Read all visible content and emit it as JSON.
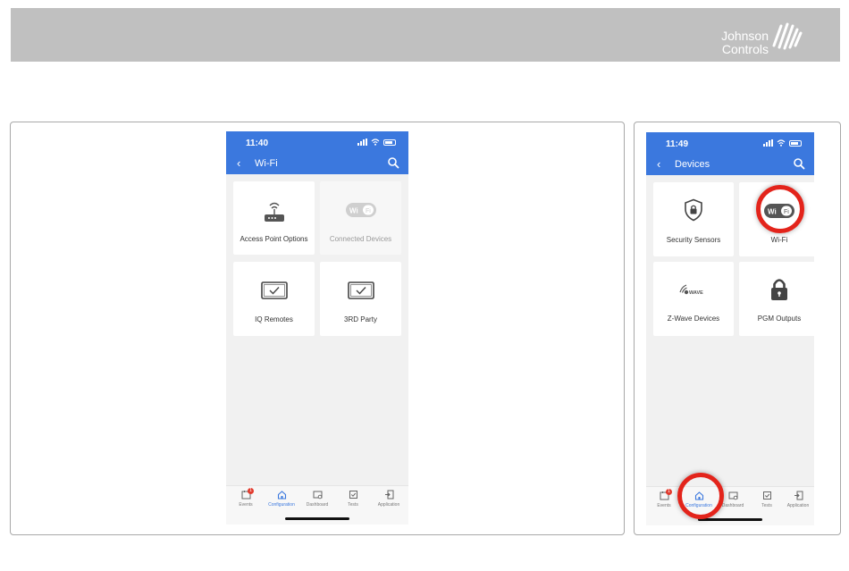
{
  "brand": {
    "line1": "Johnson",
    "line2": "Controls"
  },
  "left_phone": {
    "time": "11:40",
    "title": "Wi-Fi",
    "tiles": [
      {
        "label": "Access Point Options",
        "icon": "router-icon",
        "disabled": false
      },
      {
        "label": "Connected Devices",
        "icon": "wifi-logo-icon",
        "disabled": true
      },
      {
        "label": "IQ Remotes",
        "icon": "tablet-check-icon",
        "disabled": false
      },
      {
        "label": "3RD Party",
        "icon": "tablet-check-icon",
        "disabled": false
      }
    ],
    "tabs": [
      {
        "label": "Events",
        "icon": "events-icon",
        "badge": "1"
      },
      {
        "label": "Configuration",
        "icon": "home-icon",
        "active": true
      },
      {
        "label": "Dashboard",
        "icon": "dashboard-icon"
      },
      {
        "label": "Tests",
        "icon": "tests-icon"
      },
      {
        "label": "Application",
        "icon": "application-icon"
      }
    ]
  },
  "right_phone": {
    "time": "11:49",
    "title": "Devices",
    "tiles": [
      {
        "label": "Security Sensors",
        "icon": "shield-lock-icon"
      },
      {
        "label": "Wi-Fi",
        "icon": "wifi-logo-icon"
      },
      {
        "label": "Z-Wave Devices",
        "icon": "zwave-icon",
        "icon_text": "WAVE"
      },
      {
        "label": "PGM Outputs",
        "icon": "padlock-icon"
      }
    ],
    "tabs": [
      {
        "label": "Events",
        "icon": "events-icon",
        "badge": "1"
      },
      {
        "label": "Configuration",
        "icon": "home-icon",
        "active": true
      },
      {
        "label": "Dashboard",
        "icon": "dashboard-icon"
      },
      {
        "label": "Tests",
        "icon": "tests-icon"
      },
      {
        "label": "Application",
        "icon": "application-icon"
      }
    ]
  },
  "wifi_logo": {
    "left": "Wi",
    "right": "Fi"
  },
  "colors": {
    "header_blue": "#3b78de",
    "highlight_red": "#e3241b",
    "banner_gray": "#c0c0c0"
  }
}
